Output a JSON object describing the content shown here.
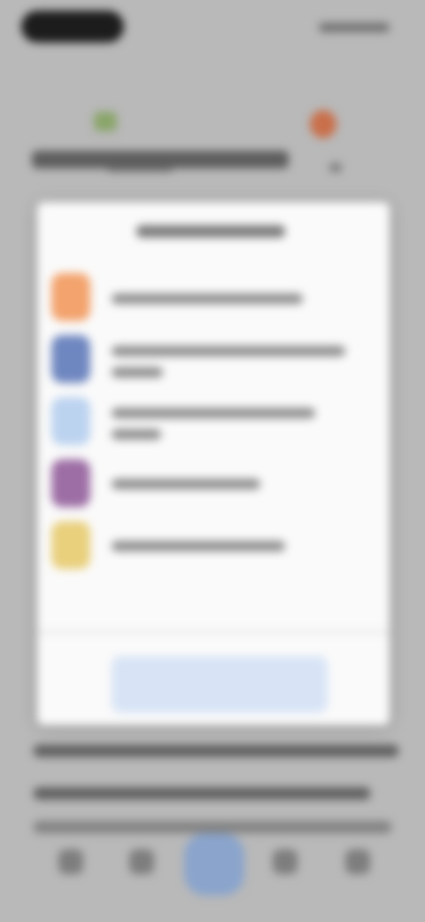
{
  "statusbar": {},
  "topnav": {},
  "modal": {
    "list_items": [
      {
        "color": "#f3a36d"
      },
      {
        "color": "#6f87c0"
      },
      {
        "color": "#bcd3f0"
      },
      {
        "color": "#9d6ea5"
      },
      {
        "color": "#e9d07d"
      }
    ],
    "action_button_color": "#d8e4f6"
  },
  "bottom_tabs": {
    "active_index": 2
  }
}
